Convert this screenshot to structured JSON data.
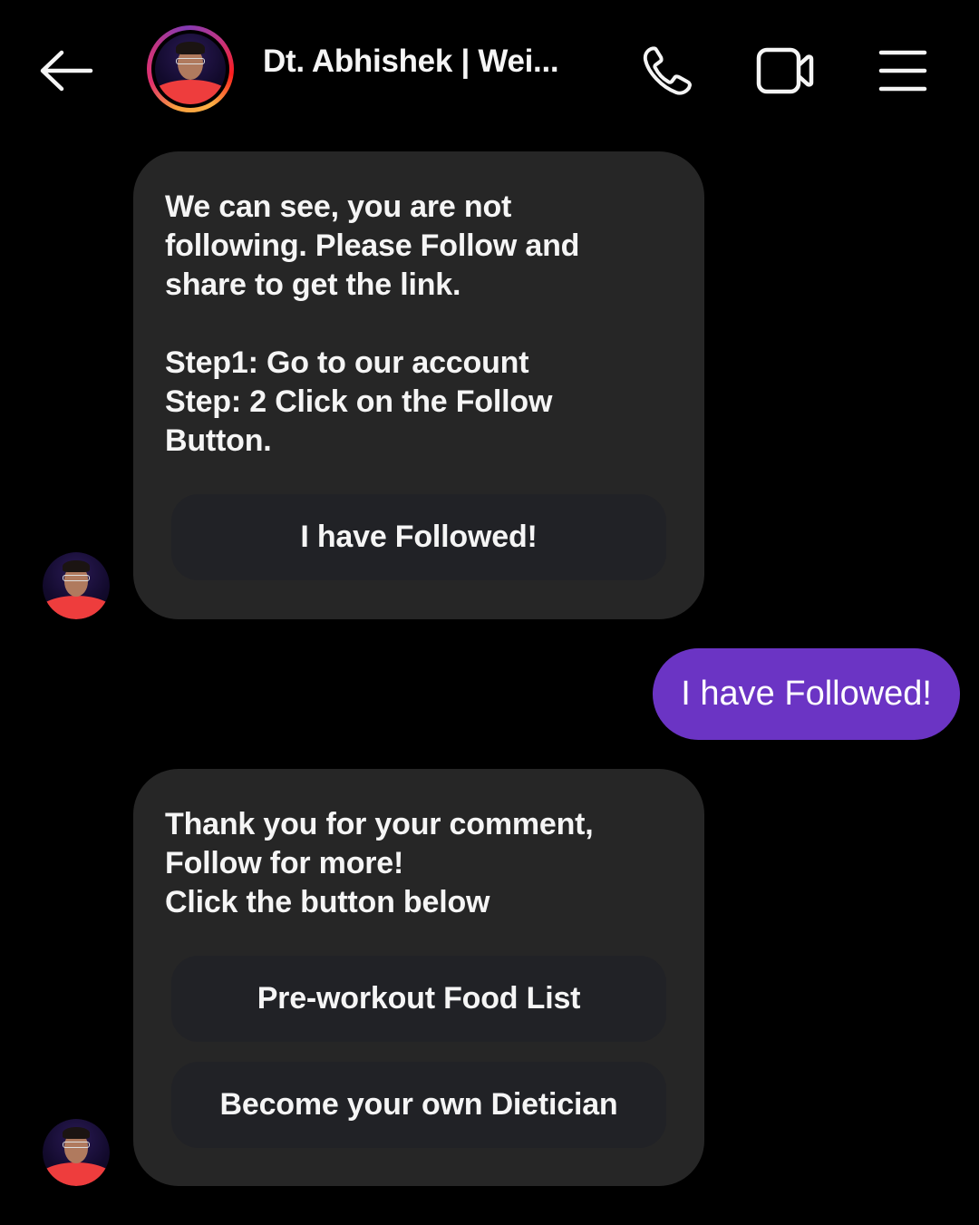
{
  "header": {
    "title": "Dt. Abhishek | Wei...",
    "back_icon": "arrow-left-icon",
    "call_icon": "phone-icon",
    "video_icon": "video-camera-icon",
    "menu_icon": "hamburger-menu-icon"
  },
  "messages": [
    {
      "direction": "incoming",
      "text": "We can see, you are not\nfollowing. Please Follow and\nshare to get the link.\n\nStep1: Go to our account\nStep: 2 Click on the Follow\nButton.",
      "buttons": [
        "I have Followed!"
      ]
    },
    {
      "direction": "outgoing",
      "text": "I have Followed!"
    },
    {
      "direction": "incoming",
      "text": "Thank you for your comment,\nFollow for more!\nClick the button below",
      "buttons": [
        "Pre-workout Food List",
        "Become your own Dietician"
      ]
    }
  ],
  "colors": {
    "background": "#000000",
    "incoming_bubble": "#262626",
    "quick_reply_button": "#212226",
    "outgoing_bubble": "#6b34c4",
    "text": "#f5f5f5"
  }
}
